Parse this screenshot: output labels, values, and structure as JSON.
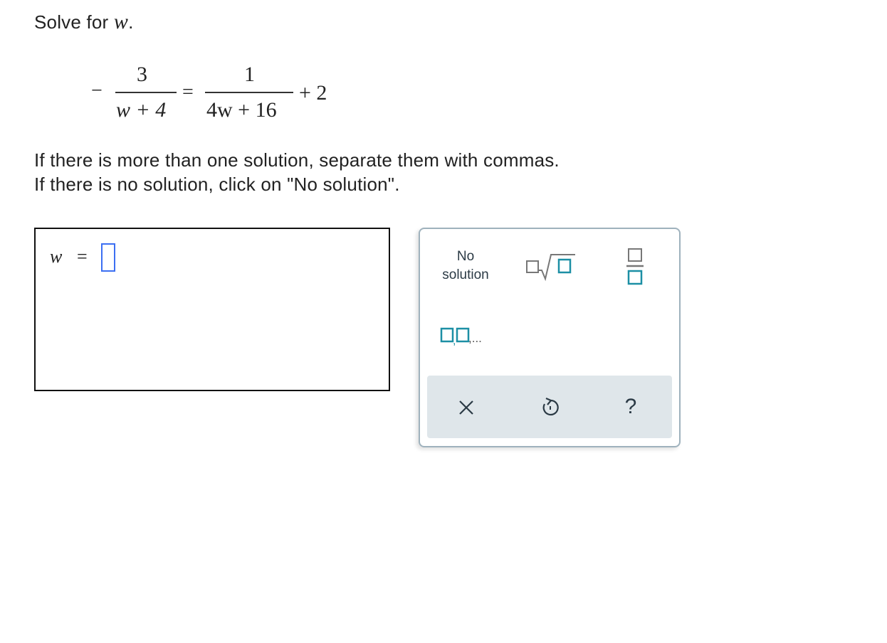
{
  "prompt": {
    "text": "Solve for",
    "variable": "w",
    "period": "."
  },
  "equation": {
    "lhs_sign": "−",
    "lhs_numerator": "3",
    "lhs_denominator": "w + 4",
    "equals": "=",
    "rhs_numerator": "1",
    "rhs_denominator": "4w + 16",
    "rhs_addend": "+ 2"
  },
  "instructions": {
    "line1": "If there is more than one solution, separate them with commas.",
    "line2": "If there is no solution, click on \"No solution\"."
  },
  "answer": {
    "variable": "w",
    "equals": "=",
    "value": ""
  },
  "palette": {
    "no_solution_line1": "No",
    "no_solution_line2": "solution",
    "buttons": [
      "no-solution",
      "nth-root",
      "fraction",
      "list"
    ],
    "list_suffix": ",..."
  },
  "toolbar": {
    "icons": [
      "clear-x-icon",
      "undo-icon",
      "help-question-icon"
    ],
    "help_label": "?"
  },
  "colors": {
    "accent_teal": "#1c8fa5",
    "cursor_blue": "#3c6ff2",
    "toolbar_bg": "#dfe6ea",
    "palette_border": "#9fb2bd"
  }
}
